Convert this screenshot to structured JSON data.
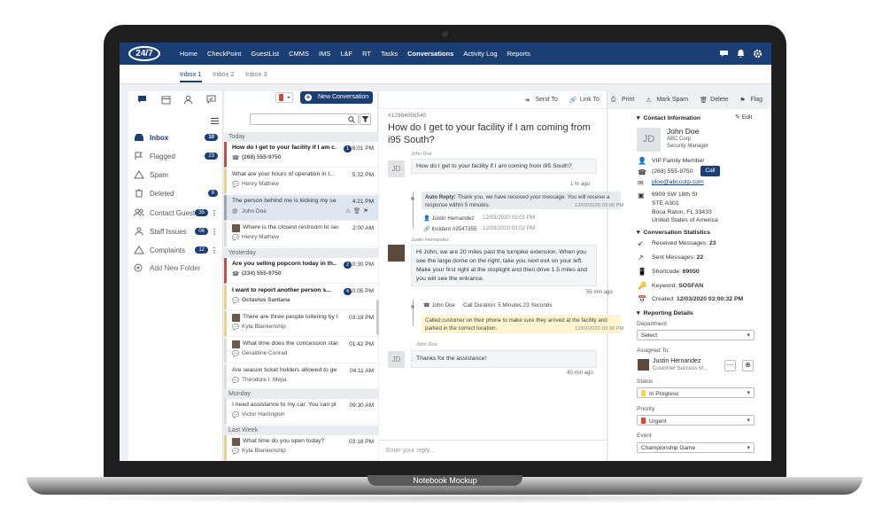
{
  "caption": "Notebook Mockup",
  "logo": "24/7",
  "topnav": [
    "Home",
    "CheckPoint",
    "GuestList",
    "CMMS",
    "IMS",
    "L&F",
    "RT",
    "Tasks",
    "Conversations",
    "Activity Log",
    "Reports"
  ],
  "subtabs": [
    "Inbox 1",
    "Inbox 2",
    "Inbox 3"
  ],
  "new_conversation": "New Conversation",
  "folders": [
    {
      "label": "Inbox",
      "count": "10"
    },
    {
      "label": "Flagged",
      "count": "23"
    },
    {
      "label": "Spam",
      "count": ""
    },
    {
      "label": "Deleted",
      "count": "9"
    },
    {
      "label": "Contact Guest",
      "count": "35"
    },
    {
      "label": "Staff Issues",
      "count": "06"
    },
    {
      "label": "Complaints",
      "count": "12"
    },
    {
      "label": "Add New Folder",
      "count": ""
    }
  ],
  "days": [
    "Today",
    "Yesterday",
    "Monday",
    "Last Week"
  ],
  "messages": [
    {
      "title": "How do I get to your facility if I am c...",
      "badge": "1",
      "time": "6:01 PM",
      "sub": "(268) 555-9750"
    },
    {
      "title": "What are your hours of operation in t...",
      "badge": "",
      "time": "5:32 PM",
      "sub": "Henry Mathew"
    },
    {
      "title": "The person behind me is kicking my seat.",
      "badge": "",
      "time": "4:21 PM",
      "sub": "John Doe"
    },
    {
      "title": "Where is the closest restroom to sec...",
      "badge": "",
      "time": "2:00 AM",
      "sub": "Henry Mathew"
    },
    {
      "title": "Are you selling popcorn today in th...",
      "badge": "2",
      "time": "10:30 PM",
      "sub": "(234) 555-9750"
    },
    {
      "title": "I want to report another person s...",
      "badge": "4",
      "time": "10:05 PM",
      "sub": "Octavius Santana"
    },
    {
      "title": "There are three people loitering by t...",
      "badge": "",
      "time": "03:18 PM",
      "sub": "Kyla Blankenship"
    },
    {
      "title": "What time does the concession stan...",
      "badge": "",
      "time": "01:42 PM",
      "sub": "Geraldine Conrad"
    },
    {
      "title": "Are season ticket holders allowed to ge...",
      "badge": "",
      "time": "04:11 AM",
      "sub": "Theodore I. Mejia"
    },
    {
      "title": "I need assistance to my car. You can plea...",
      "badge": "",
      "time": "09:30 AM",
      "sub": "Victor Harrington"
    },
    {
      "title": "What time do you open today?",
      "badge": "",
      "time": "03:18 PM",
      "sub": "Kyla Blankenship"
    }
  ],
  "actions": [
    "Send To",
    "Link To",
    "Print",
    "Mark Spam",
    "Delete",
    "Flag"
  ],
  "convo": {
    "id": "#12984056540",
    "subject": "How do I get to your facility if I am coming from i95 South?",
    "sender1": "John Doe",
    "msg1": "How do I get to your facility if I am coming from i95 South?",
    "time1": "1 hr ago",
    "auto_label": "Auto Reply:",
    "auto_text": "Thank you, we have received your message. You will receive a response within 5 minutes.",
    "auto_time": "12/03/2020 03:00 PM",
    "assign_name": "Justin Hernandez",
    "assign_time": "12/03/2020 03:01 PM",
    "incident": "Incident #3547355",
    "incident_time": "12/03/2020 03:02 PM",
    "sender2": "Justin Hernandez",
    "msg2": "Hi John, we are 20 miles past the turnpike extension. When you see the large dome on the right, take you next exit on your left. Make your first right at the stoplight and then drive 1.5 miles and you will see the entrance.",
    "time2": "55 min ago",
    "call_name": "John Doe",
    "call_dur": "Call Duration: 5 Minutes 23 Seconds",
    "call_note": "Called customer on their phone to make sure they arrived at the facility and parked in the correct location.",
    "call_time": "12/03/2020 03:36 PM",
    "sender3": "John Doe",
    "msg3": "Thanks for the assistance!",
    "time3": "40 min ago",
    "reply_placeholder": "Enter your reply..."
  },
  "contact": {
    "header": "Contact Information",
    "edit": "Edit",
    "initials": "JD",
    "name": "John Doe",
    "company": "ABC Corp",
    "role": "Security Manager",
    "member": "VIP Family Member",
    "phone": "(268) 555-9750",
    "call": "Call",
    "email": "jdoe@abccorp.com",
    "addr1": "6909 SW 18th St",
    "addr2": "STE A301",
    "addr3": "Boca Raton, FL 33433",
    "addr4": "United States of America"
  },
  "stats": {
    "header": "Conversation Statistics",
    "received_label": "Received Messages:",
    "received": "23",
    "sent_label": "Sent Messages:",
    "sent": "22",
    "shortcode_label": "Shortcode:",
    "shortcode": "69050",
    "keyword_label": "Keyword:",
    "keyword": "SOSFAN",
    "created_label": "Created:",
    "created": "12/03/2020 03:00:32 PM"
  },
  "reporting": {
    "header": "Reporting Details",
    "department_label": "Department",
    "department": "Select",
    "assigned_label": "Assigned To:",
    "assigned_name": "Justin Hernandez",
    "assigned_role": "Customer Success M...",
    "status_label": "Status",
    "status": "In Progress",
    "priority_label": "Priority",
    "priority": "Urgent",
    "event_label": "Event",
    "event": "Championship Game"
  },
  "colors": {
    "brand": "#1b3e75",
    "urgent": "#d9453a",
    "progress": "#f4d36b"
  }
}
